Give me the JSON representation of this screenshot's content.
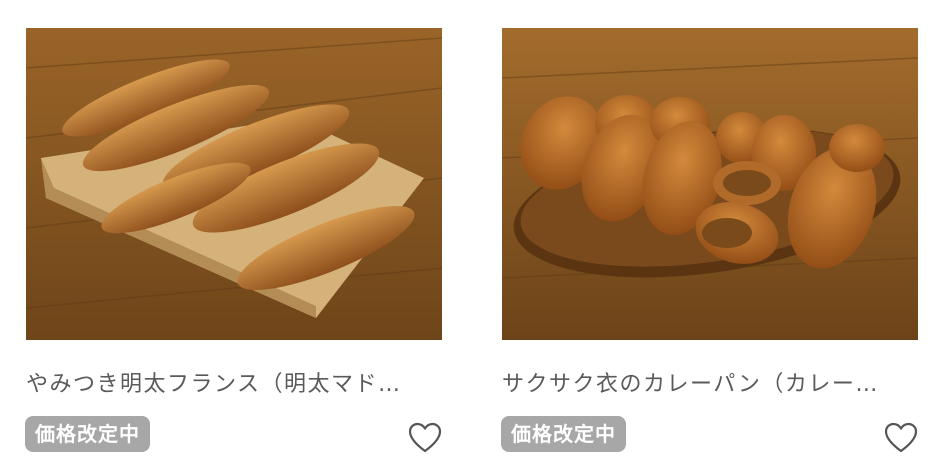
{
  "products": [
    {
      "title": "やみつき明太フランス（明太マド…",
      "badge": "価格改定中",
      "photo_icon": "mentai-france-bread-photo",
      "favorite_icon": "heart-outline-icon"
    },
    {
      "title": "サクサク衣のカレーパン（カレー…",
      "badge": "価格改定中",
      "photo_icon": "curry-bread-photo",
      "favorite_icon": "heart-outline-icon"
    }
  ],
  "colors": {
    "badge_bg": "#a7a7a7",
    "title_text": "#5a5a5a",
    "wood": "#8c5a22"
  }
}
